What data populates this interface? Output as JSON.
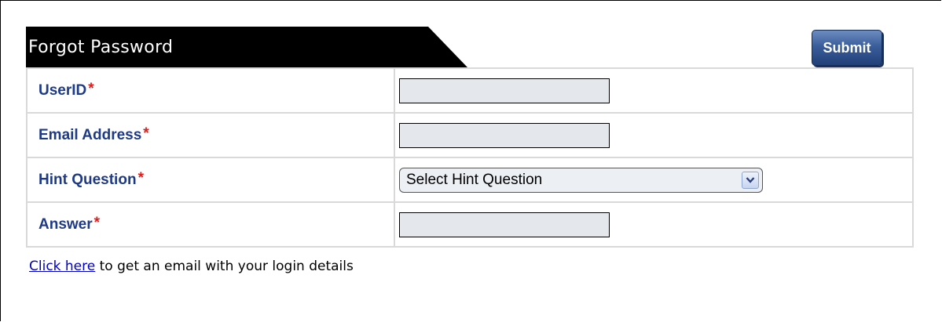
{
  "form": {
    "title": "Forgot Password",
    "submit_label": "Submit",
    "required_marker": "*",
    "fields": [
      {
        "label": "UserID",
        "type": "text",
        "value": ""
      },
      {
        "label": "Email Address",
        "type": "text",
        "value": ""
      },
      {
        "label": "Hint Question",
        "type": "select",
        "selected": "Select Hint Question"
      },
      {
        "label": "Answer",
        "type": "text",
        "value": ""
      }
    ]
  },
  "footer": {
    "link_text": "Click here",
    "rest_text": " to get an email with your login details"
  },
  "colors": {
    "label": "#1e3a86",
    "required": "#e01b1b",
    "input_bg": "#e4e8ec",
    "link": "#0000cc",
    "submit_bg": "#2e5090"
  },
  "icons": {
    "select_arrow": "chevron-down-icon"
  }
}
